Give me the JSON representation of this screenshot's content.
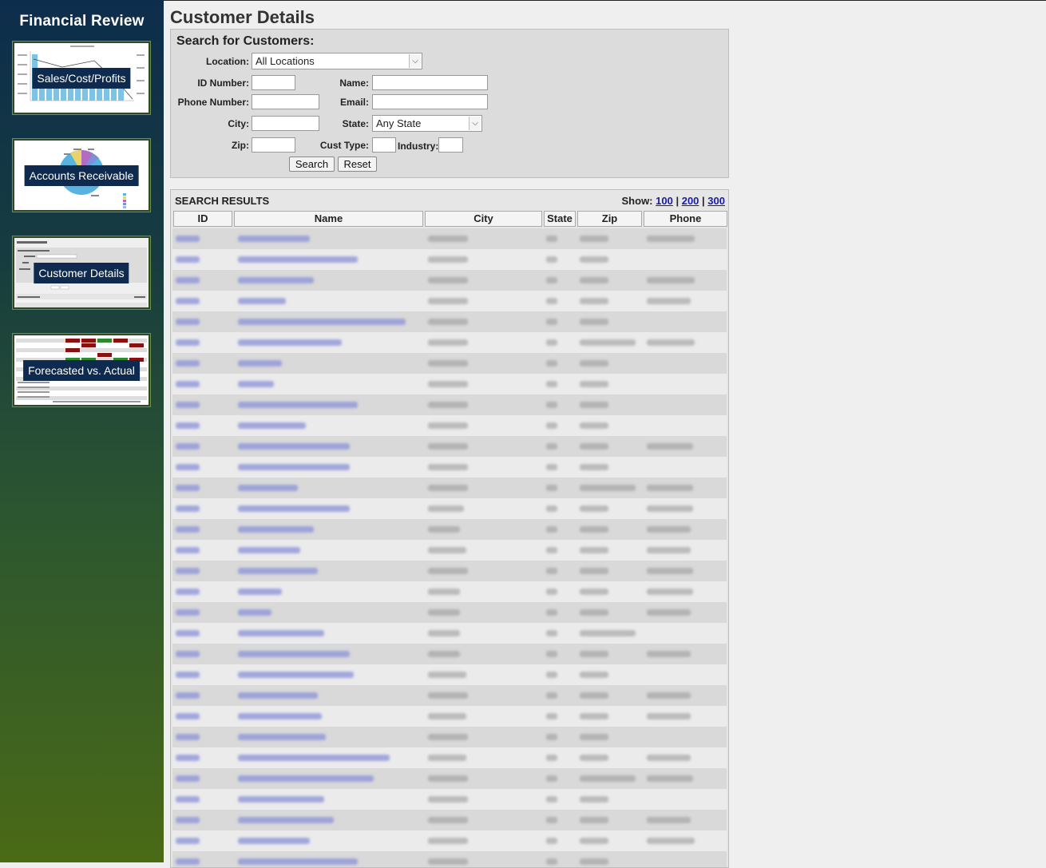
{
  "sidebar": {
    "title": "Financial Review",
    "items": [
      {
        "label": "Sales/Cost/Profits"
      },
      {
        "label": "Accounts Receivable"
      },
      {
        "label": "Customer Details"
      },
      {
        "label": "Forecasted vs. Actual"
      }
    ]
  },
  "page": {
    "title": "Customer Details"
  },
  "search": {
    "heading": "Search for Customers:",
    "location_label": "Location:",
    "location_value": "All Locations",
    "id_label": "ID Number:",
    "name_label": "Name:",
    "phone_label": "Phone Number:",
    "email_label": "Email:",
    "city_label": "City:",
    "state_label": "State:",
    "state_value": "Any State",
    "zip_label": "Zip:",
    "cust_type_label": "Cust Type:",
    "industry_label": "Industry:",
    "search_button": "Search",
    "reset_button": "Reset"
  },
  "results": {
    "heading": "SEARCH RESULTS",
    "show_label": "Show:",
    "show_options": [
      "100",
      "200",
      "300"
    ],
    "columns": [
      "ID",
      "Name",
      "City",
      "State",
      "Zip",
      "Phone"
    ],
    "link_color": "#1a1aa6"
  }
}
